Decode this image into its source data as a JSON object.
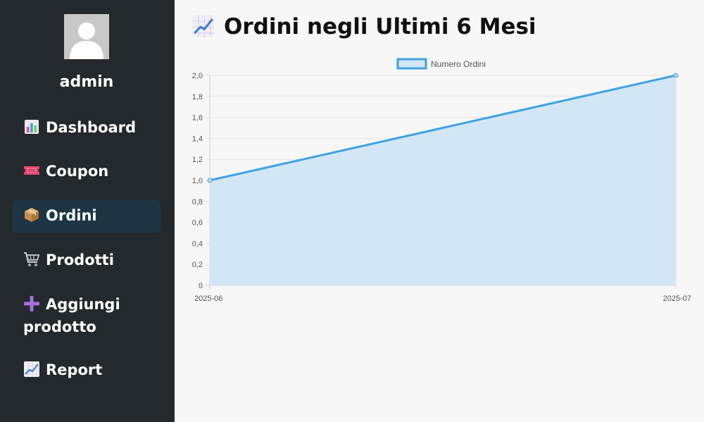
{
  "user": {
    "name": "admin",
    "avatar_icon": "user-silhouette-icon"
  },
  "nav": {
    "items": [
      {
        "label": "Dashboard",
        "icon": "bar-chart-icon",
        "active": false
      },
      {
        "label": "Coupon",
        "icon": "ticket-icon",
        "active": false
      },
      {
        "label": "Ordini",
        "icon": "package-icon",
        "active": true
      },
      {
        "label": "Prodotti",
        "icon": "shopping-cart-icon",
        "active": false
      },
      {
        "label": "Aggiungi prodotto",
        "icon": "plus-icon",
        "active": false
      },
      {
        "label": "Report",
        "icon": "chart-increasing-icon",
        "active": false
      }
    ]
  },
  "page": {
    "title": "Ordini negli Ultimi 6 Mesi",
    "icon": "chart-increasing-icon"
  },
  "colors": {
    "sidebar_bg": "#24292e",
    "active_item_bg": "#1e3544",
    "line": "#3ea2e3",
    "fill": "#d2e6f6"
  },
  "chart_data": {
    "type": "area",
    "x": [
      "2025-06",
      "2025-07"
    ],
    "series": [
      {
        "name": "Numero Ordini",
        "values": [
          1,
          2
        ]
      }
    ],
    "ylim": [
      0,
      2
    ],
    "yticks": [
      "0",
      "0,2",
      "0,4",
      "0,6",
      "0,8",
      "1,0",
      "1,2",
      "1,4",
      "1,6",
      "1,8",
      "2,0"
    ],
    "grid": true,
    "legend": "top-center"
  }
}
